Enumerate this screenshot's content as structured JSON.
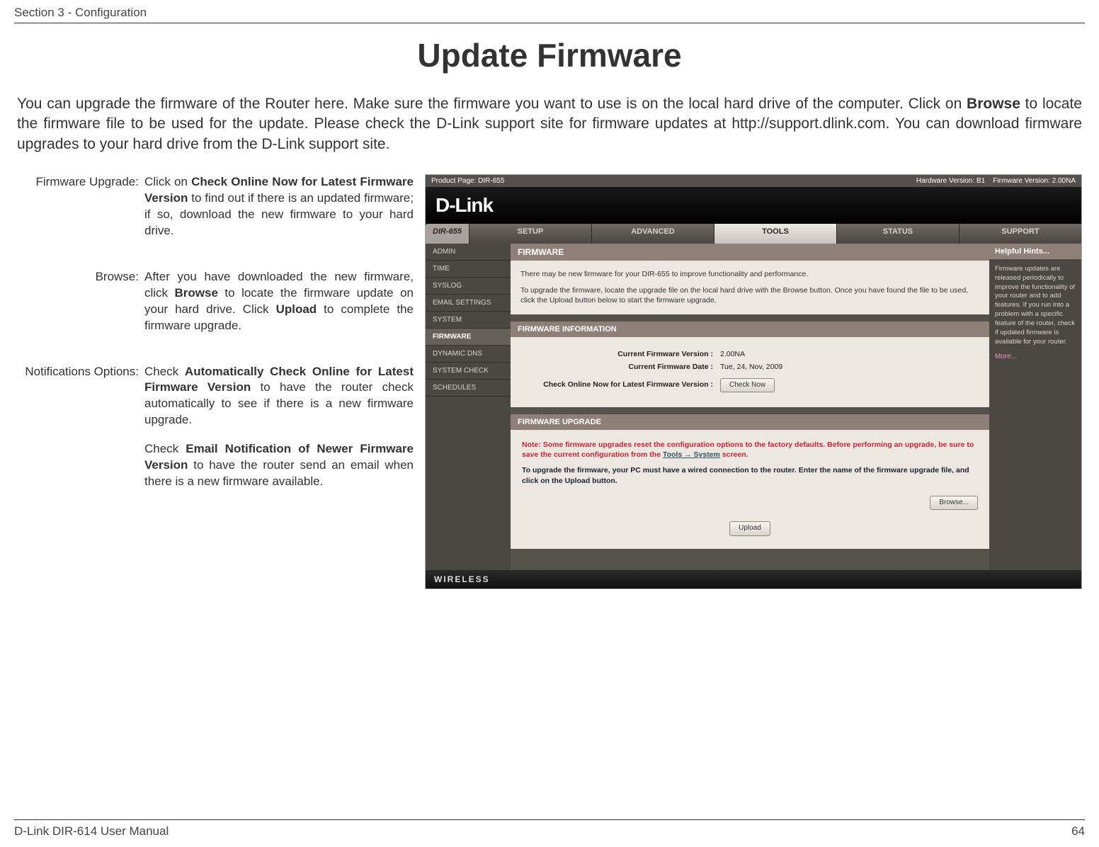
{
  "header": {
    "section": "Section 3 - Configuration"
  },
  "title": "Update Firmware",
  "intro": {
    "part1": "You can upgrade the firmware of the Router here. Make sure the firmware you want to use is on the local hard drive of the computer. Click on ",
    "bold1": "Browse",
    "part2": " to locate the firmware file to be used for the update. Please check the D-Link support site for firmware updates at http://support.dlink.com. You can download firmware upgrades to your hard drive from the D-Link support site."
  },
  "defs": {
    "firmware_label": "Firmware Upgrade:",
    "firmware_p1a": "Click on ",
    "firmware_p1b": "Check Online Now for Latest Firmware Version",
    "firmware_p1c": " to find out if there is an updated firmware; if so, download the new firmware to your hard drive.",
    "browse_label": "Browse:",
    "browse_p1a": "After you have downloaded the new firmware, click ",
    "browse_p1b": "Browse",
    "browse_p1c": " to locate the firmware update on your hard drive. Click ",
    "browse_p1d": "Upload",
    "browse_p1e": " to complete the firmware upgrade.",
    "notif_label": "Notifications Options:",
    "notif_p1a": "Check ",
    "notif_p1b": "Automatically Check Online for Latest Firmware Version",
    "notif_p1c": " to have the router check automatically to see if there is a new firmware upgrade.",
    "notif_p2a": "Check ",
    "notif_p2b": "Email Notification of Newer Firmware Version",
    "notif_p2c": " to have the router send an email when there is a new firmware available."
  },
  "ss": {
    "product": "Product Page: DIR-655",
    "hw": "Hardware Version: B1",
    "fw": "Firmware Version: 2.00NA",
    "logo": "D-Link",
    "model": "DIR-655",
    "tabs": [
      "SETUP",
      "ADVANCED",
      "TOOLS",
      "STATUS",
      "SUPPORT"
    ],
    "sidebar": [
      "ADMIN",
      "TIME",
      "SYSLOG",
      "EMAIL SETTINGS",
      "SYSTEM",
      "FIRMWARE",
      "DYNAMIC DNS",
      "SYSTEM CHECK",
      "SCHEDULES"
    ],
    "panel_title": "FIRMWARE",
    "panel_txt1": "There may be new firmware for your DIR-655 to improve functionality and performance.",
    "panel_txt2": "To upgrade the firmware, locate the upgrade file on the local hard drive with the Browse button. Once you have found the file to be used, click the Upload button below to start the firmware upgrade.",
    "info_title": "FIRMWARE INFORMATION",
    "info_k1": "Current Firmware Version :",
    "info_v1": "2.00NA",
    "info_k2": "Current Firmware Date :",
    "info_v2": "Tue, 24, Nov, 2009",
    "info_k3": "Check Online Now for Latest Firmware Version :",
    "btn_check": "Check Now",
    "upgrade_title": "FIRMWARE UPGRADE",
    "note1a": "Note: Some firmware upgrades reset the configuration options to the factory defaults. Before performing an upgrade, be sure to save the current configuration from the ",
    "note1b": "Tools → System",
    "note1c": " screen.",
    "note2": "To upgrade the firmware, your PC must have a wired connection to the router. Enter the name of the firmware upgrade file, and click on the Upload button.",
    "btn_browse": "Browse...",
    "btn_upload": "Upload",
    "hints_title": "Helpful Hints...",
    "hints_body": "Firmware updates are released periodically to improve the functionality of your router and to add features. If you run into a problem with a specific feature of the router, check if updated firmware is available for your router.",
    "hints_more": "More...",
    "wireless": "WIRELESS"
  },
  "footer": {
    "left": "D-Link DIR-614 User Manual",
    "right": "64"
  }
}
